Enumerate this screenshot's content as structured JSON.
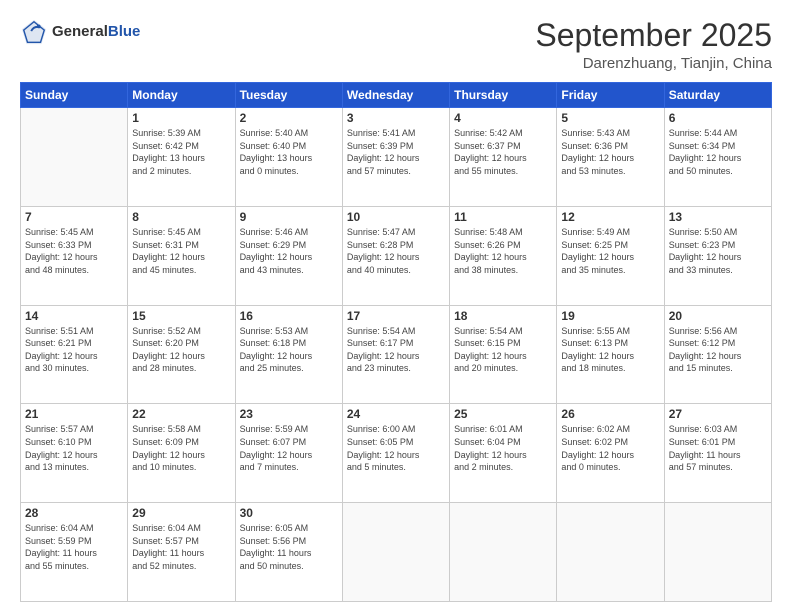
{
  "logo": {
    "general": "General",
    "blue": "Blue"
  },
  "header": {
    "month_title": "September 2025",
    "location": "Darenzhuang, Tianjin, China"
  },
  "days_of_week": [
    "Sunday",
    "Monday",
    "Tuesday",
    "Wednesday",
    "Thursday",
    "Friday",
    "Saturday"
  ],
  "weeks": [
    [
      {
        "date": "",
        "info": ""
      },
      {
        "date": "1",
        "info": "Sunrise: 5:39 AM\nSunset: 6:42 PM\nDaylight: 13 hours\nand 2 minutes."
      },
      {
        "date": "2",
        "info": "Sunrise: 5:40 AM\nSunset: 6:40 PM\nDaylight: 13 hours\nand 0 minutes."
      },
      {
        "date": "3",
        "info": "Sunrise: 5:41 AM\nSunset: 6:39 PM\nDaylight: 12 hours\nand 57 minutes."
      },
      {
        "date": "4",
        "info": "Sunrise: 5:42 AM\nSunset: 6:37 PM\nDaylight: 12 hours\nand 55 minutes."
      },
      {
        "date": "5",
        "info": "Sunrise: 5:43 AM\nSunset: 6:36 PM\nDaylight: 12 hours\nand 53 minutes."
      },
      {
        "date": "6",
        "info": "Sunrise: 5:44 AM\nSunset: 6:34 PM\nDaylight: 12 hours\nand 50 minutes."
      }
    ],
    [
      {
        "date": "7",
        "info": "Sunrise: 5:45 AM\nSunset: 6:33 PM\nDaylight: 12 hours\nand 48 minutes."
      },
      {
        "date": "8",
        "info": "Sunrise: 5:45 AM\nSunset: 6:31 PM\nDaylight: 12 hours\nand 45 minutes."
      },
      {
        "date": "9",
        "info": "Sunrise: 5:46 AM\nSunset: 6:29 PM\nDaylight: 12 hours\nand 43 minutes."
      },
      {
        "date": "10",
        "info": "Sunrise: 5:47 AM\nSunset: 6:28 PM\nDaylight: 12 hours\nand 40 minutes."
      },
      {
        "date": "11",
        "info": "Sunrise: 5:48 AM\nSunset: 6:26 PM\nDaylight: 12 hours\nand 38 minutes."
      },
      {
        "date": "12",
        "info": "Sunrise: 5:49 AM\nSunset: 6:25 PM\nDaylight: 12 hours\nand 35 minutes."
      },
      {
        "date": "13",
        "info": "Sunrise: 5:50 AM\nSunset: 6:23 PM\nDaylight: 12 hours\nand 33 minutes."
      }
    ],
    [
      {
        "date": "14",
        "info": "Sunrise: 5:51 AM\nSunset: 6:21 PM\nDaylight: 12 hours\nand 30 minutes."
      },
      {
        "date": "15",
        "info": "Sunrise: 5:52 AM\nSunset: 6:20 PM\nDaylight: 12 hours\nand 28 minutes."
      },
      {
        "date": "16",
        "info": "Sunrise: 5:53 AM\nSunset: 6:18 PM\nDaylight: 12 hours\nand 25 minutes."
      },
      {
        "date": "17",
        "info": "Sunrise: 5:54 AM\nSunset: 6:17 PM\nDaylight: 12 hours\nand 23 minutes."
      },
      {
        "date": "18",
        "info": "Sunrise: 5:54 AM\nSunset: 6:15 PM\nDaylight: 12 hours\nand 20 minutes."
      },
      {
        "date": "19",
        "info": "Sunrise: 5:55 AM\nSunset: 6:13 PM\nDaylight: 12 hours\nand 18 minutes."
      },
      {
        "date": "20",
        "info": "Sunrise: 5:56 AM\nSunset: 6:12 PM\nDaylight: 12 hours\nand 15 minutes."
      }
    ],
    [
      {
        "date": "21",
        "info": "Sunrise: 5:57 AM\nSunset: 6:10 PM\nDaylight: 12 hours\nand 13 minutes."
      },
      {
        "date": "22",
        "info": "Sunrise: 5:58 AM\nSunset: 6:09 PM\nDaylight: 12 hours\nand 10 minutes."
      },
      {
        "date": "23",
        "info": "Sunrise: 5:59 AM\nSunset: 6:07 PM\nDaylight: 12 hours\nand 7 minutes."
      },
      {
        "date": "24",
        "info": "Sunrise: 6:00 AM\nSunset: 6:05 PM\nDaylight: 12 hours\nand 5 minutes."
      },
      {
        "date": "25",
        "info": "Sunrise: 6:01 AM\nSunset: 6:04 PM\nDaylight: 12 hours\nand 2 minutes."
      },
      {
        "date": "26",
        "info": "Sunrise: 6:02 AM\nSunset: 6:02 PM\nDaylight: 12 hours\nand 0 minutes."
      },
      {
        "date": "27",
        "info": "Sunrise: 6:03 AM\nSunset: 6:01 PM\nDaylight: 11 hours\nand 57 minutes."
      }
    ],
    [
      {
        "date": "28",
        "info": "Sunrise: 6:04 AM\nSunset: 5:59 PM\nDaylight: 11 hours\nand 55 minutes."
      },
      {
        "date": "29",
        "info": "Sunrise: 6:04 AM\nSunset: 5:57 PM\nDaylight: 11 hours\nand 52 minutes."
      },
      {
        "date": "30",
        "info": "Sunrise: 6:05 AM\nSunset: 5:56 PM\nDaylight: 11 hours\nand 50 minutes."
      },
      {
        "date": "",
        "info": ""
      },
      {
        "date": "",
        "info": ""
      },
      {
        "date": "",
        "info": ""
      },
      {
        "date": "",
        "info": ""
      }
    ]
  ]
}
